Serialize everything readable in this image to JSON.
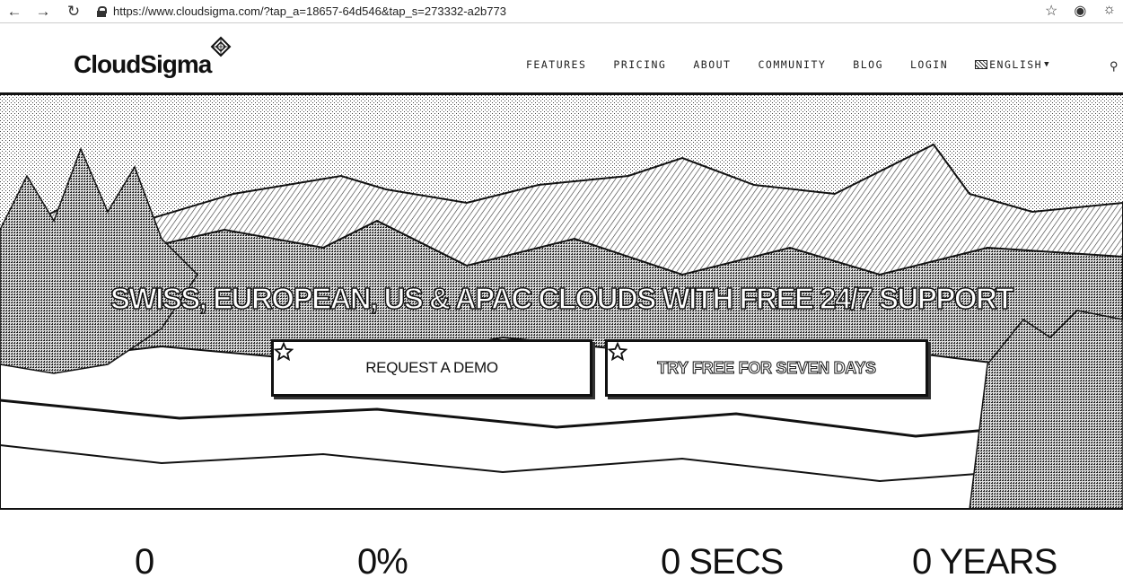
{
  "browser": {
    "url": "https://www.cloudsigma.com/?tap_a=18657-64d546&tap_s=273332-a2b773",
    "back_icon": "arrow-left-icon",
    "forward_icon": "arrow-right-icon",
    "reload_icon": "reload-icon",
    "bookmark_icon": "star-icon",
    "extension_icon": "extension-icon",
    "menu_icon": "profile-icon"
  },
  "header": {
    "logo_text": "CloudSigma",
    "nav": [
      {
        "label": "FEATURES"
      },
      {
        "label": "PRICING"
      },
      {
        "label": "ABOUT"
      },
      {
        "label": "COMMUNITY"
      },
      {
        "label": "BLOG"
      },
      {
        "label": "LOGIN"
      }
    ],
    "language": "ENGLISH"
  },
  "hero": {
    "title": "SWISS, EUROPEAN, US & APAC CLOUDS WITH FREE 24/7 SUPPORT",
    "buttons": [
      {
        "label": "REQUEST A DEMO"
      },
      {
        "label": "TRY FREE FOR SEVEN DAYS"
      }
    ]
  },
  "stats": [
    {
      "value": "0"
    },
    {
      "value": "0%"
    },
    {
      "value": "0 SECS"
    },
    {
      "value": "0 YEARS"
    }
  ]
}
